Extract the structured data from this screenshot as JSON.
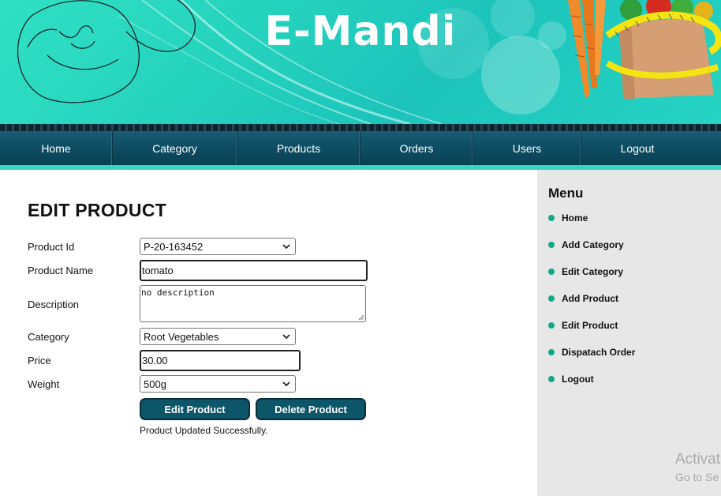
{
  "header": {
    "title": "E-Mandi"
  },
  "nav": {
    "items": [
      {
        "label": "Home"
      },
      {
        "label": "Category"
      },
      {
        "label": "Products"
      },
      {
        "label": "Orders"
      },
      {
        "label": "Users"
      },
      {
        "label": "Logout"
      }
    ]
  },
  "form": {
    "title": "EDIT PRODUCT",
    "product_id": {
      "label": "Product Id",
      "value": "P-20-163452"
    },
    "product_name": {
      "label": "Product Name",
      "value": "tomato"
    },
    "description": {
      "label": "Description",
      "value": "no description"
    },
    "category": {
      "label": "Category",
      "value": "Root Vegetables"
    },
    "price": {
      "label": "Price",
      "value": "30.00"
    },
    "weight": {
      "label": "Weight",
      "value": "500g"
    },
    "edit_button": "Edit Product",
    "delete_button": "Delete Product",
    "status": "Product Updated Successfully."
  },
  "sidebar": {
    "title": "Menu",
    "items": [
      {
        "label": "Home"
      },
      {
        "label": "Add Category"
      },
      {
        "label": "Edit Category"
      },
      {
        "label": "Add Product"
      },
      {
        "label": "Edit Product"
      },
      {
        "label": "Dispatach Order"
      },
      {
        "label": "Logout"
      }
    ]
  },
  "watermark": {
    "line1": "Activat",
    "line2": "Go to Se"
  },
  "colors": {
    "accent": "#13a785",
    "nav": "#0f4f66",
    "button": "#0d5569",
    "header": "#25d2bd"
  }
}
